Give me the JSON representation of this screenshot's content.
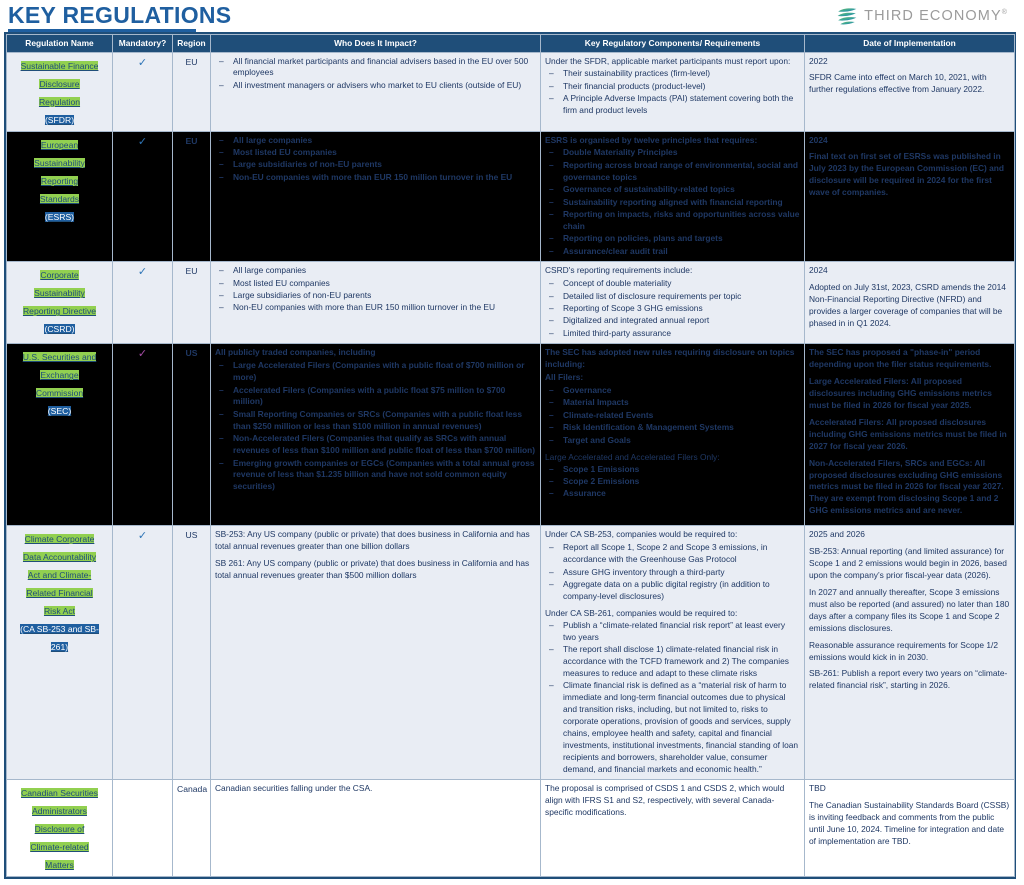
{
  "header": {
    "title": "KEY REGULATIONS",
    "logo_text": "THIRD ECONOMY",
    "logo_trademark": "®",
    "logo_icon": "third-economy-swoosh-icon",
    "accent_color": "#1f5fa0",
    "header_bg_color": "#1f4e79",
    "highlight_color": "#92d050"
  },
  "table": {
    "columns": [
      "Regulation Name",
      "Mandatory?",
      "Region",
      "Who Does It Impact?",
      "Key Regulatory Components/ Requirements",
      "Date of Implementation"
    ],
    "rows": [
      {
        "name_lines": [
          "Sustainable Finance",
          "Disclosure",
          "Regulation",
          "(SFDR)"
        ],
        "name_highlight": [
          true,
          true,
          true,
          false
        ],
        "mandatory": "✓",
        "mandatory_color": "#2e75b6",
        "region": "EU",
        "impact_lead": "",
        "impact_items": [
          "All financial market participants and financial advisers based in the EU over 500 employees",
          "All investment managers or advisers who market to EU clients (outside of EU)"
        ],
        "req_lead": "Under the SFDR, applicable market participants must report upon:",
        "req_items": [
          "Their sustainability practices (firm-level)",
          "Their financial products (product-level)",
          "A Principle Adverse Impacts (PAI) statement covering both the firm and product levels"
        ],
        "date_year": "2022",
        "date_note": "SFDR Came into effect on March 10, 2021, with further regulations effective from January 2022.",
        "style": "light"
      },
      {
        "name_lines": [
          "European",
          "Sustainability",
          "Reporting",
          "Standards",
          "(ESRS)"
        ],
        "name_highlight": [
          true,
          true,
          true,
          true,
          false
        ],
        "mandatory": "✓",
        "mandatory_color": "#2e75b6",
        "region": "EU",
        "impact_lead": "",
        "impact_items": [
          "All large companies",
          "Most listed EU companies",
          "Large subsidiaries of non-EU parents",
          "Non-EU companies with more than EUR 150 million turnover in the EU"
        ],
        "req_lead": "ESRS is organised by twelve principles that requires:",
        "req_items": [
          "Double Materiality Principles",
          "Reporting across broad range of environmental, social and governance topics",
          "Governance of sustainability-related topics",
          "Sustainability reporting aligned with financial reporting",
          "Reporting on impacts, risks and opportunities across value chain",
          "Reporting on policies, plans and targets",
          "Assurance/clear audit trail"
        ],
        "date_year": "2024",
        "date_note": "Final text on first set of ESRSs was published in July 2023 by the European Commission (EC) and disclosure will be required in 2024 for the first wave of companies.",
        "style": "dark"
      },
      {
        "name_lines": [
          "Corporate",
          "Sustainability",
          "Reporting Directive",
          "(CSRD)"
        ],
        "name_highlight": [
          true,
          true,
          true,
          false
        ],
        "mandatory": "✓",
        "mandatory_color": "#2e75b6",
        "region": "EU",
        "impact_lead": "",
        "impact_items": [
          "All large companies",
          "Most listed EU companies",
          "Large subsidiaries of non-EU parents",
          "Non-EU companies with more than EUR 150 million turnover in the EU"
        ],
        "req_lead": "CSRD's reporting requirements include:",
        "req_items": [
          "Concept of double materiality",
          "Detailed list of disclosure requirements per topic",
          "Reporting of Scope 3 GHG emissions",
          "Digitalized and integrated annual report",
          "Limited third-party assurance"
        ],
        "date_year": "2024",
        "date_note": "Adopted on July 31st, 2023, CSRD amends the 2014 Non-Financial Reporting Directive (NFRD) and provides a larger coverage of companies that will be phased in in Q1 2024.",
        "style": "light"
      },
      {
        "name_lines": [
          "U.S. Securities and",
          "Exchange",
          "Commission",
          "(SEC)"
        ],
        "name_highlight": [
          true,
          true,
          true,
          false
        ],
        "mandatory": "✓",
        "mandatory_color": "#a64ca6",
        "region": "US",
        "impact_lead": "All publicly traded companies, including",
        "impact_items": [
          "Large Accelerated Filers (Companies with a public float of $700 million or more)",
          "Accelerated Filers (Companies with a public float $75 million to $700 million)",
          "Small Reporting Companies or SRCs (Companies with a public float less than $250 million or less than $100 million in annual revenues)",
          "Non-Accelerated Filers (Companies that qualify as SRCs with annual revenues of less than $100 million and public float of less than $700 million)",
          "Emerging growth companies or EGCs (Companies with a total annual gross revenue of less than $1.235 billion and have not sold common equity securities)"
        ],
        "req_lead": "The SEC has adopted new rules requiring disclosure on topics including:",
        "req_subhead_1": "All Filers:",
        "req_items": [
          "Governance",
          "Material Impacts",
          "Climate-related Events",
          "Risk Identification & Management Systems",
          "Target and Goals"
        ],
        "req_subhead_2": "Large Accelerated and Accelerated Filers Only:",
        "req_items_2": [
          "Scope 1 Emissions",
          "Scope 2 Emissions",
          "Assurance"
        ],
        "date_paras": [
          "The SEC has proposed a \"phase-in\" period depending upon the filer status requirements.",
          "Large Accelerated Filers: All proposed disclosures including GHG emissions metrics must be filed in 2026 for fiscal year 2025.",
          "Accelerated Filers: All proposed disclosures including GHG emissions metrics must be filed in 2027 for fiscal year 2026.",
          "Non-Accelerated Filers, SRCs and EGCs: All proposed disclosures excluding GHG emissions metrics must be filed in 2026 for fiscal year 2027. They are exempt from disclosing Scope 1 and 2 GHG emissions metrics and are never."
        ],
        "style": "dark"
      },
      {
        "name_lines": [
          "Climate Corporate",
          "Data Accountability",
          "Act and Climate-",
          "Related Financial",
          "Risk Act",
          "(CA SB-253 and SB-",
          "261)"
        ],
        "name_highlight": [
          true,
          true,
          true,
          true,
          true,
          false,
          false
        ],
        "mandatory": "✓",
        "mandatory_color": "#2e75b6",
        "region": "US",
        "impact_paras": [
          "SB-253: Any US company (public or private) that does business in California and has total annual revenues greater than one billion dollars",
          "SB 261: Any US company  (public or private) that does business in California and has total annual revenues greater than $500 million dollars"
        ],
        "req_lead": "Under CA SB-253, companies would be required to:",
        "req_items": [
          "Report all Scope 1, Scope 2 and Scope 3 emissions, in accordance with the  Greenhouse Gas Protocol",
          "Assure GHG inventory through a third-party",
          "Aggregate data  on a public digital registry (in addition to company-level disclosures)"
        ],
        "req_lead_2": "Under CA SB-261, companies would be required to:",
        "req_items_2": [
          "Publish a “climate-related financial risk report” at least every two years",
          "The report shall disclose 1) climate-related financial risk in accordance with the TCFD framework and 2) The companies measures to reduce and adapt to these climate risks",
          "Climate financial risk is defined  as a “material risk of harm to immediate and long-term financial outcomes due to physical and transition risks, including, but not limited to, risks to corporate operations, provision of goods and services, supply chains, employee health and safety, capital and financial investments, institutional investments, financial standing of loan recipients and borrowers, shareholder value, consumer demand, and financial markets and economic health.”"
        ],
        "date_year": "2025 and 2026",
        "date_paras": [
          "SB-253: Annual reporting (and limited assurance) for Scope 1 and 2 emissions would begin in 2026, based upon the company’s prior fiscal-year data (2026).",
          "In 2027 and annually thereafter, Scope 3 emissions must also be reported (and assured) no later than 180 days after a company files its Scope 1 and Scope 2 emissions disclosures.",
          "Reasonable assurance requirements for Scope 1/2 emissions would kick in in 2030.",
          "SB-261: Publish a report every two years on “climate-related financial risk”, starting in 2026."
        ],
        "style": "light"
      },
      {
        "name_lines": [
          "Canadian Securities",
          "Administrators",
          "Disclosure of",
          "Climate-related",
          "Matters"
        ],
        "name_highlight": [
          true,
          true,
          true,
          true,
          true
        ],
        "mandatory": "",
        "mandatory_color": "#2e75b6",
        "region": "Canada",
        "impact_paras": [
          "Canadian securities falling under the CSA."
        ],
        "req_paras": [
          "The proposal is comprised of CSDS 1 and CSDS 2, which would align with IFRS S1 and S2, respectively, with several Canada-specific modifications."
        ],
        "date_year": "TBD",
        "date_paras": [
          "The Canadian Sustainability Standards Board (CSSB) is inviting feedback and comments from the public until June 10, 2024. Timeline for integration and date of implementation are TBD."
        ],
        "style": "white"
      }
    ]
  }
}
